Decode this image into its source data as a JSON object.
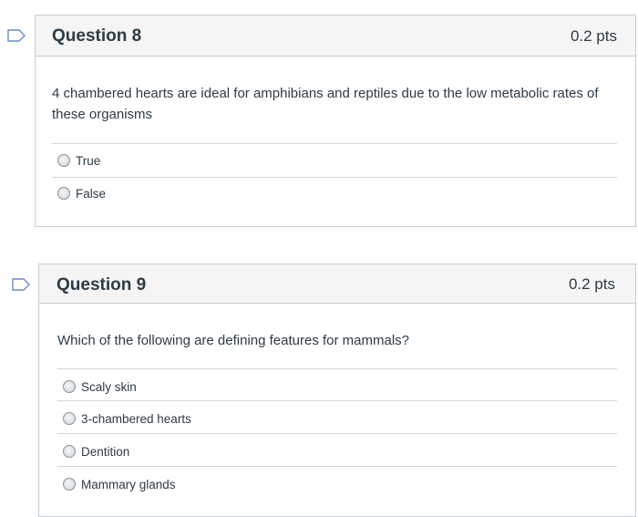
{
  "questions": [
    {
      "title": "Question 8",
      "points": "0.2 pts",
      "text": "4 chambered hearts are ideal for amphibians and reptiles due to the low metabolic rates of these organisms",
      "answers": [
        "True",
        "False"
      ]
    },
    {
      "title": "Question 9",
      "points": "0.2 pts",
      "text": "Which of the following are defining features for mammals?",
      "answers": [
        "Scaly skin",
        "3-chambered hearts",
        "Dentition",
        "Mammary glands"
      ]
    }
  ],
  "colors": {
    "header_bg": "#f5f5f5",
    "border": "#c7cdd1",
    "text": "#2d3b45",
    "flag": "#6b8bc4"
  },
  "icons": {
    "flag": "bookmark-flag-icon",
    "radio": "radio-button-icon"
  }
}
